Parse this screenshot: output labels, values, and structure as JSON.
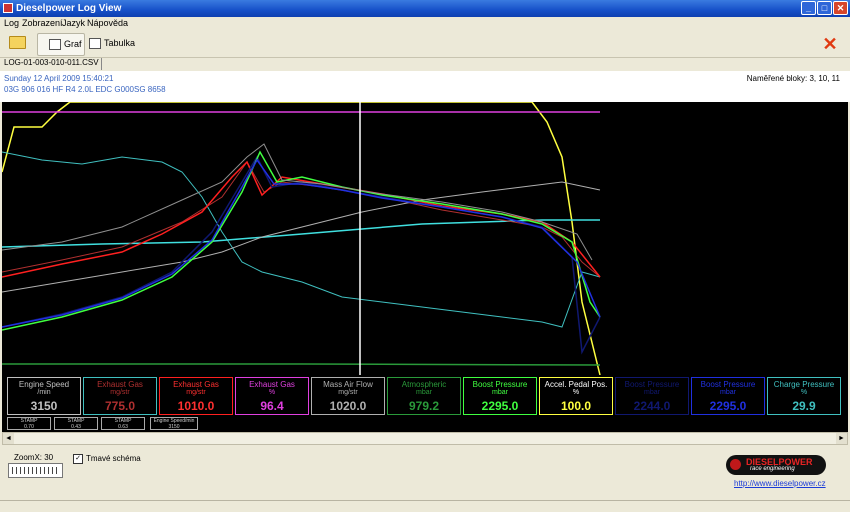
{
  "window": {
    "title": "Dieselpower Log View",
    "min_label": "_",
    "max_label": "□",
    "close_label": "✕"
  },
  "menu": [
    "Log",
    "Zobrazení",
    "Jazyk",
    "Nápověda"
  ],
  "toolbar": {
    "open_icon": "folder-open-icon",
    "tab_graph": "Graf",
    "tab_table": "Tabulka",
    "exit_icon": "red-x-icon",
    "exit_symbol": "✕"
  },
  "file_tab": "LOG-01-003-010-011.CSV",
  "info": {
    "date": "Sunday 12 April 2009 15:40:21",
    "ecu": "03G 906 016 HF  R4 2.0L EDC G000SG  8658",
    "blocks": "Naměřené bloky: 3, 10, 11"
  },
  "gauges": [
    {
      "name": "Engine Speed",
      "unit": "/min",
      "value": "3150",
      "color": "#c0c0c0"
    },
    {
      "name": "Exhaust Gas",
      "unit": "mg/str",
      "value": "775.0",
      "color": "#b03030"
    },
    {
      "name": "Exhaust Gas",
      "unit": "mg/str",
      "value": "1010.0",
      "color": "#ff2020"
    },
    {
      "name": "Exhaust Gas",
      "unit": "%",
      "value": "96.4",
      "color": "#e040e0"
    },
    {
      "name": "Mass Air Flow",
      "unit": "mg/str",
      "value": "1020.0",
      "color": "#b0b0b0"
    },
    {
      "name": "Atmospheric",
      "unit": "mbar",
      "value": "979.2",
      "color": "#2a9a3a"
    },
    {
      "name": "Boost Pressure",
      "unit": "mbar",
      "value": "2295.0",
      "color": "#40ff40"
    },
    {
      "name": "Accel. Pedal Pos.",
      "unit": "%",
      "value": "100.0",
      "color": "#ffff40"
    },
    {
      "name": "Boost Pressure",
      "unit": "mbar",
      "value": "2244.0",
      "color": "#101870"
    },
    {
      "name": "Boost Pressure",
      "unit": "mbar",
      "value": "2295.0",
      "color": "#2030e0"
    },
    {
      "name": "Charge Pressure",
      "unit": "%",
      "value": "29.9",
      "color": "#40c0c0"
    }
  ],
  "stamps": [
    {
      "label": "STAMP",
      "value": "0.70"
    },
    {
      "label": "STAMP",
      "value": "0.43"
    },
    {
      "label": "STAMP",
      "value": "0.63"
    },
    {
      "label": "Engine Speed/min",
      "value": "3150"
    }
  ],
  "zoom_label": "ZoomX: 30",
  "dark_scheme_label": "Tmavé schéma",
  "dark_scheme_checked": "✓",
  "logo": {
    "line1": "DIESELPOWER",
    "line2": "race engineering"
  },
  "website": "http://www.dieselpower.cz",
  "scroll": {
    "left": "◄",
    "right": "►"
  }
}
